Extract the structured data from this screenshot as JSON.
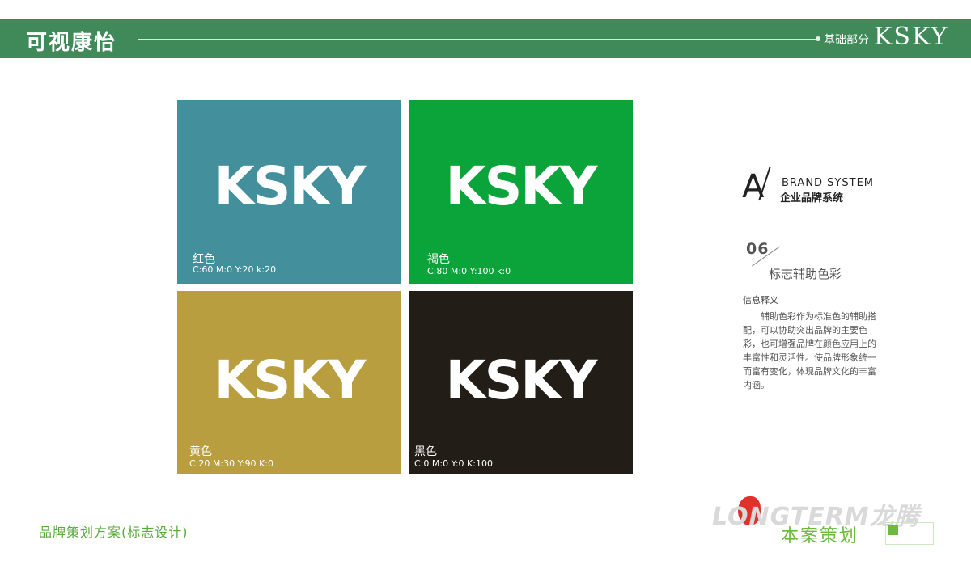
{
  "header": {
    "title": "可视康怡",
    "section": "基础部分",
    "brand": "KSKY"
  },
  "cards": [
    {
      "logo": "KSKY",
      "name": "红色",
      "cmyk": "C:60 M:0 Y:20 k:20",
      "color": "#448f9c"
    },
    {
      "logo": "KSKY",
      "name": "褐色",
      "cmyk": "C:80 M:0 Y:100 k:0",
      "color": "#0aa43a"
    },
    {
      "logo": "KSKY",
      "name": "黄色",
      "cmyk": "C:20  M:30  Y:90  K:0",
      "color": "#b99e40"
    },
    {
      "logo": "KSKY",
      "name": "黑色",
      "cmyk": "C:0  M:0  Y:0  K:100",
      "color": "#221d17"
    }
  ],
  "panel": {
    "letter": "A",
    "brand_system": "BRAND SYSTEM",
    "brand_system_cn": "企业品牌系统",
    "section_number": "06",
    "section_title": "标志辅助色彩",
    "info_heading": "信息释义",
    "info_body": "辅助色彩作为标准色的辅助搭配，可以协助突出品牌的主要色彩，也可增强品牌在颜色应用上的丰富性和灵活性。使品牌形象统一而富有变化，体现品牌文化的丰富内涵。"
  },
  "footer": {
    "plan_title": "品牌策划方案(标志设计)",
    "company_logo": "LONGTERM龙腾",
    "slogan": "本案策划"
  }
}
